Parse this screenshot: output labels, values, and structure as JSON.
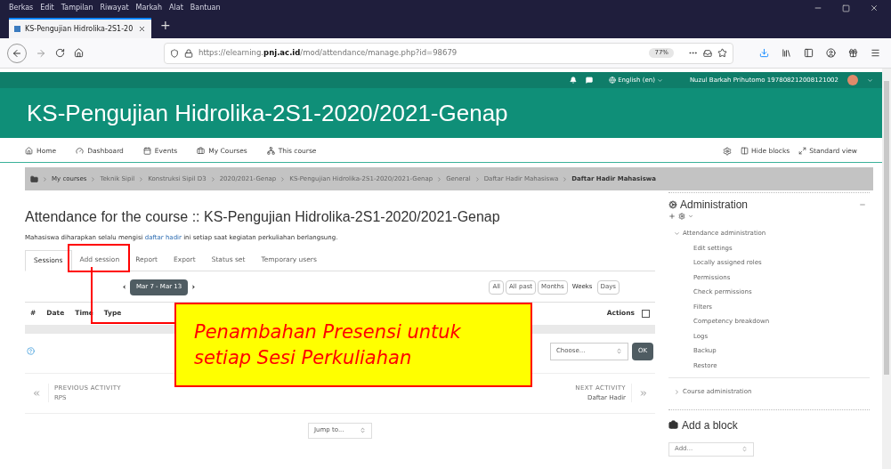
{
  "menu_bar": [
    "Berkas",
    "Edit",
    "Tampilan",
    "Riwayat",
    "Markah",
    "Alat",
    "Bantuan"
  ],
  "browser": {
    "tab_title": "KS-Pengujian Hidrolika-2S1-20",
    "new_tab": "+",
    "url": "https://elearning.**pnj.ac.id**/mod/attendance/manage.php?id=98679",
    "zoom": "77%"
  },
  "user_bar": {
    "language": "English (en)",
    "user_name": "Nuzul Barkah Prihutomo 197808212008121002"
  },
  "course_title": "KS-Pengujian Hidrolika-2S1-2020/2021-Genap",
  "nav": [
    "Home",
    "Dashboard",
    "Events",
    "My Courses",
    "This course"
  ],
  "nav_right": [
    "Hide blocks",
    "Standard view"
  ],
  "breadcrumb": [
    {
      "label": "My courses",
      "current": false
    },
    {
      "label": "Teknik Sipil",
      "current": false
    },
    {
      "label": "Konstruksi Sipil D3",
      "current": false
    },
    {
      "label": "2020/2021-Genap",
      "current": false
    },
    {
      "label": "KS-Pengujian Hidrolika-2S1-2020/2021-Genap",
      "current": false
    },
    {
      "label": "General",
      "current": false
    },
    {
      "label": "Daftar Hadir Mahasiswa",
      "current": false
    },
    {
      "label": "Daftar Hadir Mahasiswa",
      "current": true
    }
  ],
  "page": {
    "heading": "Attendance for the course :: KS-Pengujian Hidrolika-2S1-2020/2021-Genap",
    "intro_before": "Mahasiswa diharapkan selalu mengisi",
    "intro_link": "daftar hadir",
    "intro_after": "ini setiap saat kegiatan perkuliahan berlangsung.",
    "tabs": [
      {
        "label": "Sessions",
        "selected": true
      },
      {
        "label": "Add session",
        "selected": false
      },
      {
        "label": "Report",
        "selected": false
      },
      {
        "label": "Export",
        "selected": false
      },
      {
        "label": "Status set",
        "selected": false
      },
      {
        "label": "Temporary users",
        "selected": false
      }
    ],
    "date_range": "Mar 7 - Mar 13",
    "periods": [
      {
        "label": "All",
        "selected": false
      },
      {
        "label": "All past",
        "selected": false
      },
      {
        "label": "Months",
        "selected": false
      },
      {
        "label": "Weeks",
        "selected": true
      },
      {
        "label": "Days",
        "selected": false
      }
    ],
    "columns": [
      "#",
      "Date",
      "Time",
      "Type"
    ],
    "actions_column": "Actions",
    "select_all_checked": false,
    "action_select": "Choose...",
    "ok_button": "OK",
    "prev_label": "PREVIOUS ACTIVITY",
    "prev_name": "RPS",
    "next_label": "NEXT ACTIVITY",
    "next_name": "Daftar Hadir",
    "jump_select": "Jump to..."
  },
  "sidebar": {
    "admin_title": "Administration",
    "sections": [
      {
        "label": "Attendance administration",
        "expanded": true,
        "items": [
          "Edit settings",
          "Locally assigned roles",
          "Permissions",
          "Check permissions",
          "Filters",
          "Competency breakdown",
          "Logs",
          "Backup",
          "Restore"
        ]
      },
      {
        "label": "Course administration",
        "expanded": false
      }
    ],
    "add_block_title": "Add a block",
    "add_select": "Add..."
  },
  "annotation": {
    "lines": [
      "Penambahan Presensi untuk",
      "setiap Sesi Perkuliahan"
    ]
  }
}
